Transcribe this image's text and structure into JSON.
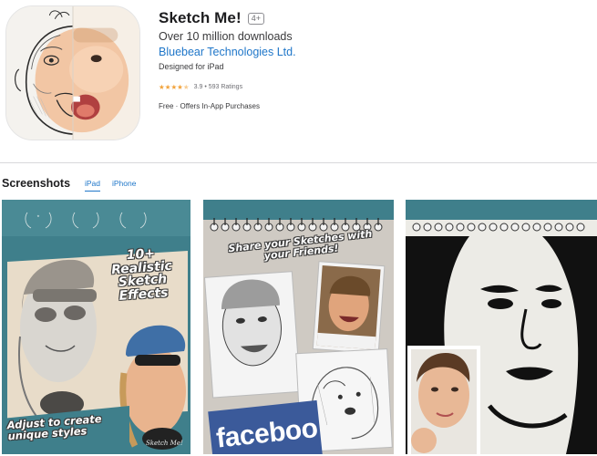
{
  "app": {
    "title": "Sketch Me!",
    "age_rating": "4+",
    "subtitle": "Over 10 million downloads",
    "developer": "Bluebear Technologies Ltd.",
    "designed_for": "Designed for iPad",
    "rating_stars": 3.9,
    "rating_text": "3.9 • 593 Ratings",
    "price": "Free · Offers In-App Purchases",
    "icon": "sketch-baby-face-icon"
  },
  "screenshots": {
    "heading": "Screenshots",
    "tabs": [
      {
        "label": "iPad",
        "active": true
      },
      {
        "label": "iPhone",
        "active": false
      }
    ],
    "items": [
      {
        "headline": "10+ Realistic Sketch Effects",
        "footer": "Adjust to create unique styles",
        "brand": "Sketch Me!"
      },
      {
        "headline": "Share your Sketches with your Friends!",
        "facebook": "faceboo"
      },
      {
        "description": "black-and-white stencil portrait with inset photo"
      }
    ]
  },
  "colors": {
    "link": "#2077c9",
    "star": "#f2a33c",
    "teal": "#3f7f8b",
    "facebook": "#3b5a9a"
  }
}
